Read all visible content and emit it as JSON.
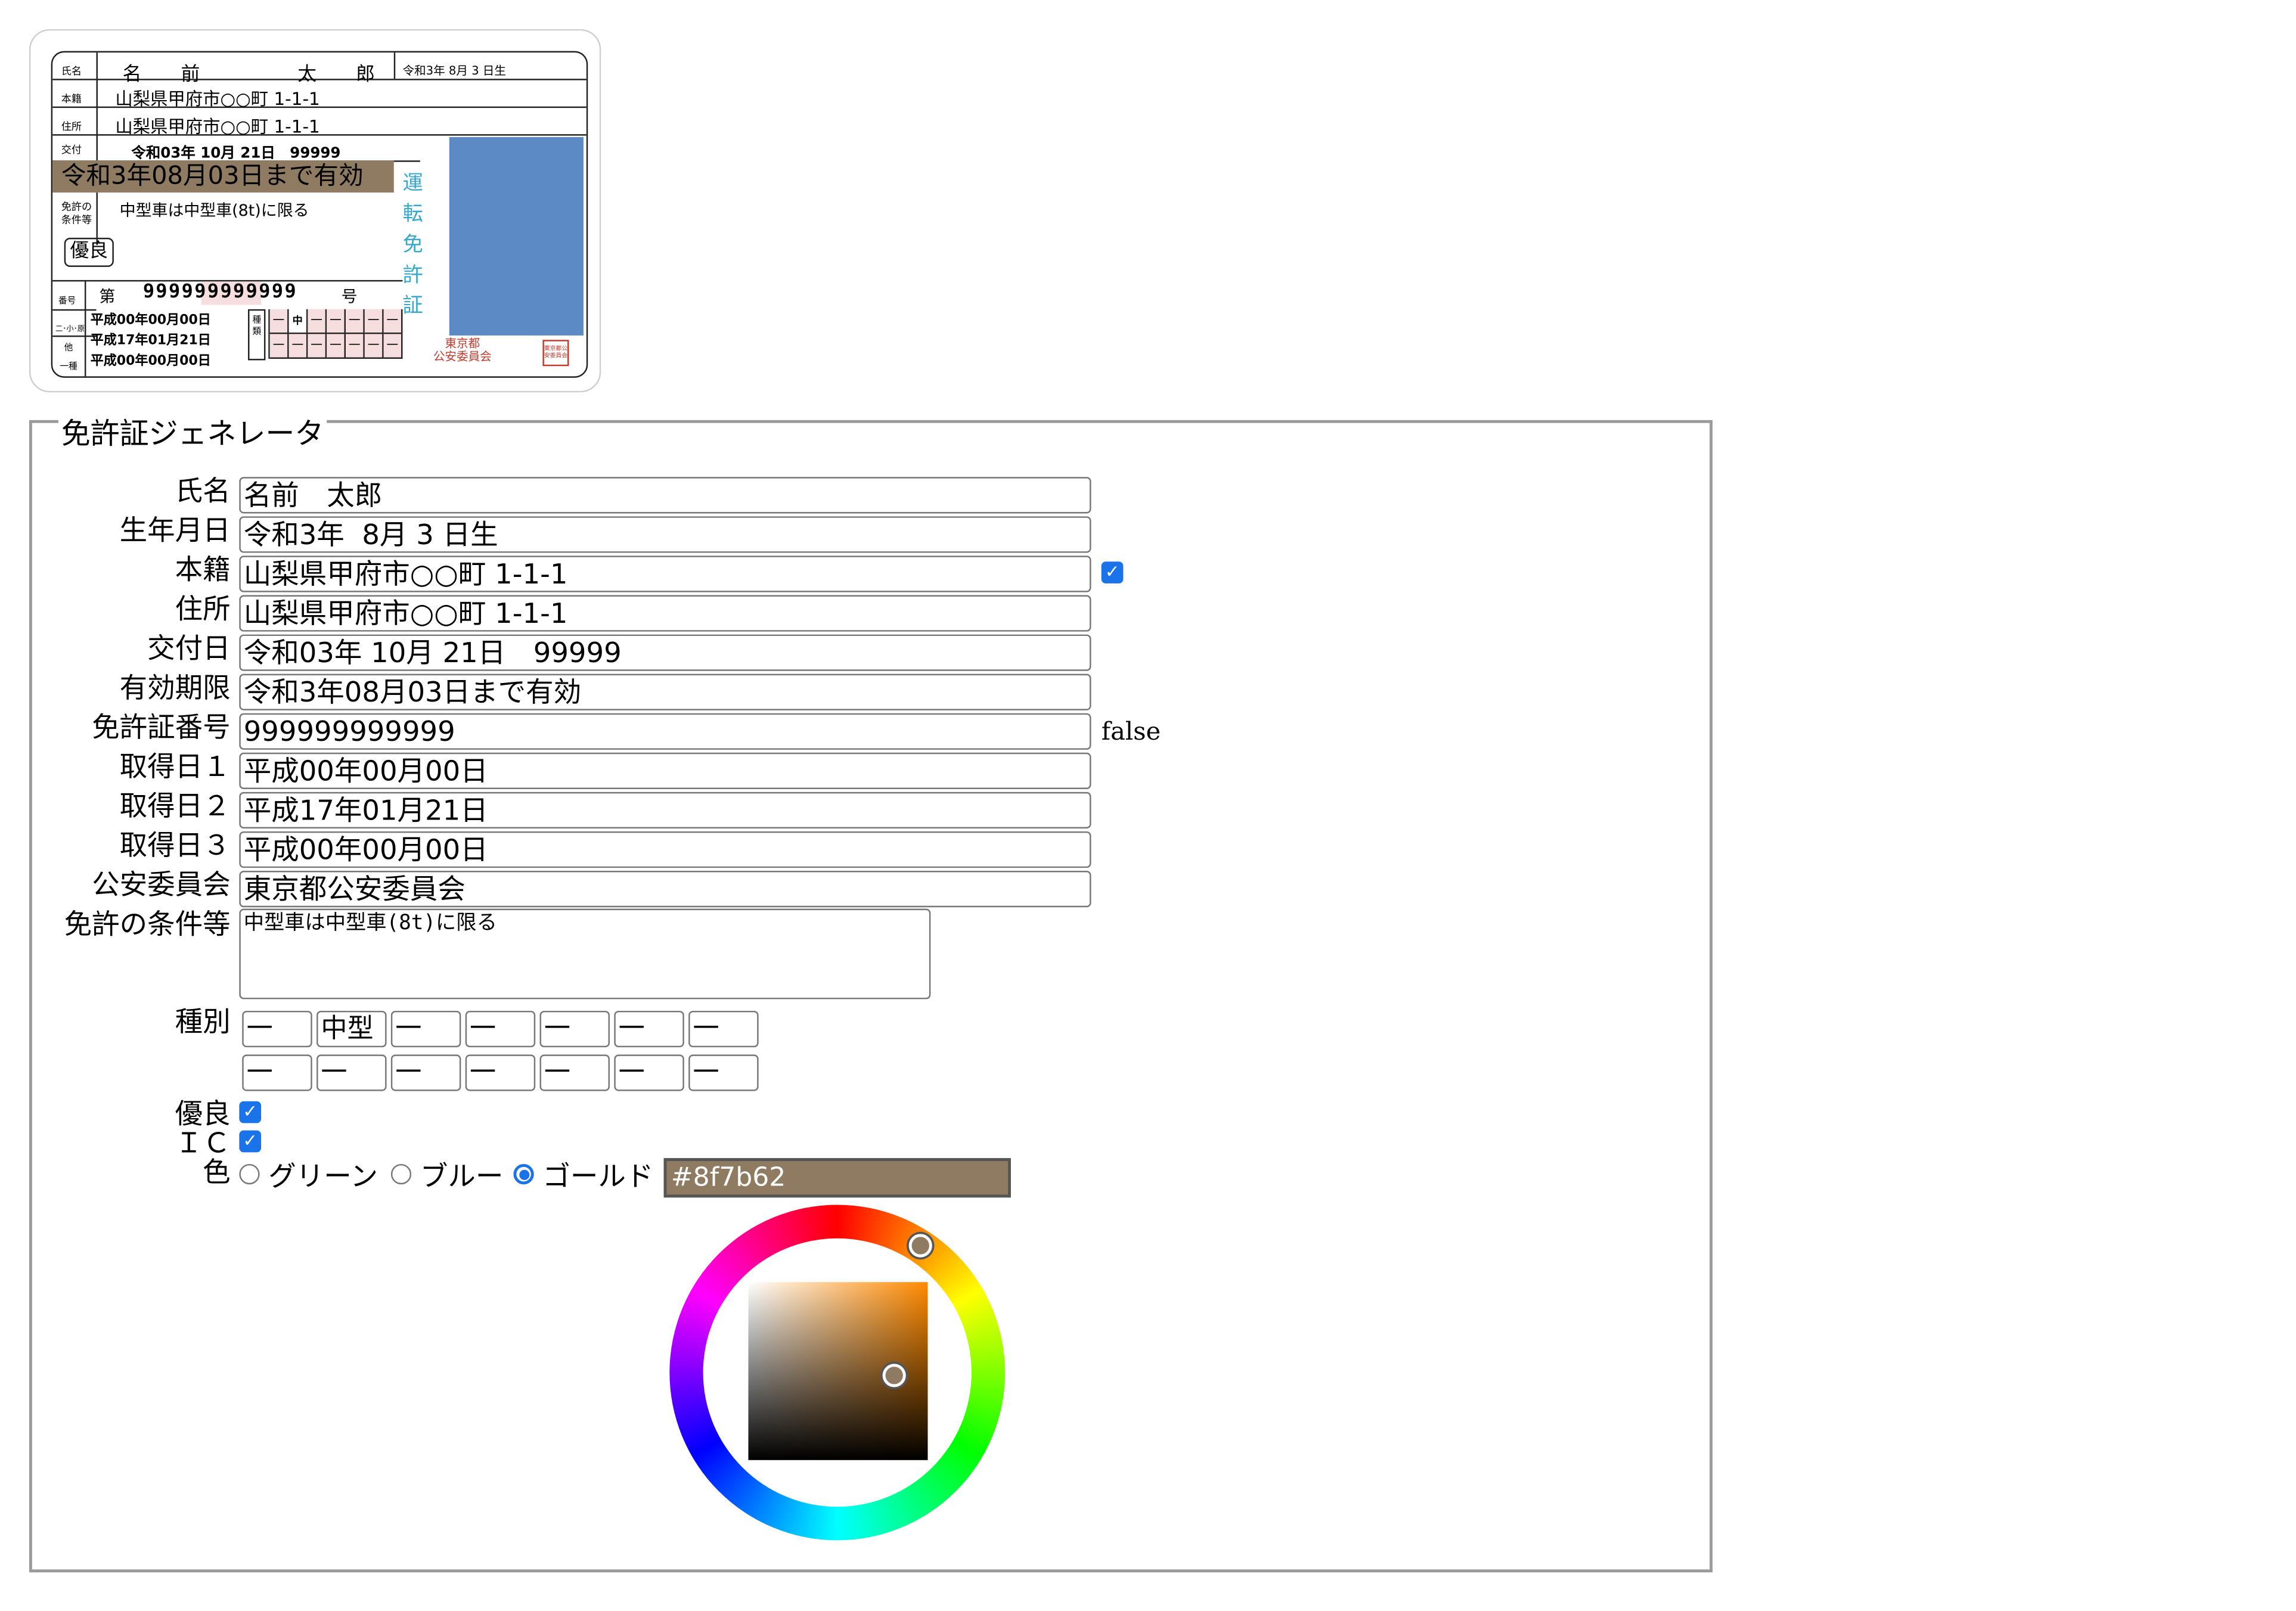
{
  "card": {
    "label_name": "氏名",
    "name_a": "名",
    "name_b": "前",
    "name_c": "太",
    "name_d": "郎",
    "birth": "令和3年 8月 3 日生",
    "label_honseki": "本籍",
    "honseki": "山梨県甲府市○○町 1-1-1",
    "label_address": "住所",
    "address": "山梨県甲府市○○町 1-1-1",
    "label_issue": "交付",
    "issue": "令和03年 10月 21日　99999",
    "expiry": "令和3年08月03日まで有効",
    "label_conditions_1": "免許の",
    "label_conditions_2": "条件等",
    "conditions": "中型車は中型車(8t)に限る",
    "yuryo": "優良",
    "vertical_title": [
      "運",
      "転",
      "免",
      "許",
      "証"
    ],
    "label_number": "番号",
    "number_prefix": "第",
    "number": "999999999999",
    "number_suffix": "号",
    "label_nishou": "二･小･原",
    "label_other": "他",
    "label_ichishu": "一種",
    "date1": "平成00年00月00日",
    "date2": "平成17年01月21日",
    "date3": "平成00年00月00日",
    "label_kinds": "種類",
    "kinds_row1": [
      "一",
      "中型",
      "一",
      "一",
      "一",
      "一",
      "一"
    ],
    "kinds_row2": [
      "一",
      "一",
      "一",
      "一",
      "一",
      "一",
      "一"
    ],
    "committee_1": "東京都",
    "committee_2": "公安委員会",
    "seal_text": "東京都公安委員会"
  },
  "form": {
    "legend": "免許証ジェネレータ",
    "name_label": "氏名",
    "name_value": "名前　太郎",
    "birth_label": "生年月日",
    "birth_value": "令和3年  8月 3 日生",
    "honseki_label": "本籍",
    "honseki_value": "山梨県甲府市○○町 1-1-1",
    "honseki_checked": true,
    "address_label": "住所",
    "address_value": "山梨県甲府市○○町 1-1-1",
    "issue_label": "交付日",
    "issue_value": "令和03年 10月 21日　99999",
    "expiry_label": "有効期限",
    "expiry_value": "令和3年08月03日まで有効",
    "number_label": "免許証番号",
    "number_value": "999999999999",
    "number_status": "false",
    "acq1_label": "取得日１",
    "acq1_value": "平成00年00月00日",
    "acq2_label": "取得日２",
    "acq2_value": "平成17年01月21日",
    "acq3_label": "取得日３",
    "acq3_value": "平成00年00月00日",
    "committee_label": "公安委員会",
    "committee_value": "東京都公安委員会",
    "conditions_label": "免許の条件等",
    "conditions_value": "中型車は中型車(8t)に限る",
    "kinds_label": "種別",
    "kinds_row1": [
      "一",
      "中型",
      "一",
      "一",
      "一",
      "一",
      "一"
    ],
    "kinds_row2": [
      "一",
      "一",
      "一",
      "一",
      "一",
      "一",
      "一"
    ],
    "yuryo_label": "優良",
    "yuryo_checked": true,
    "ic_label": "ＩＣ",
    "ic_checked": true,
    "color_label": "色",
    "color_options": [
      "グリーン",
      "ブルー",
      "ゴールド"
    ],
    "color_selected": "ゴールド",
    "color_hex": "#8f7b62"
  },
  "colors": {
    "gold": "#8f7b62",
    "photo": "#5b8ac5",
    "title_cyan": "#35a8cc",
    "seal_red": "#c0392b",
    "checkbox_blue": "#1a73e8"
  }
}
